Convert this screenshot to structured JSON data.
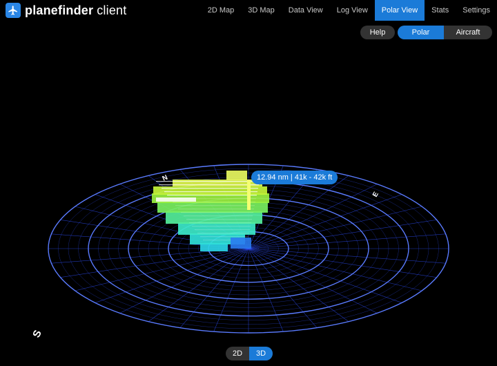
{
  "app": {
    "brand_bold": "plane",
    "brand_mid": "finder",
    "brand_rest": "client"
  },
  "nav": {
    "items": [
      {
        "label": "2D Map",
        "active": false
      },
      {
        "label": "3D Map",
        "active": false
      },
      {
        "label": "Data View",
        "active": false
      },
      {
        "label": "Log View",
        "active": false
      },
      {
        "label": "Polar View",
        "active": true
      },
      {
        "label": "Stats",
        "active": false
      },
      {
        "label": "Settings",
        "active": false
      }
    ]
  },
  "controls": {
    "help_label": "Help",
    "polar_label": "Polar",
    "aircraft_label": "Aircraft",
    "view_2d_label": "2D",
    "view_3d_label": "3D",
    "view_selected": "3D"
  },
  "polar": {
    "compass": {
      "north": "N",
      "east": "E",
      "south": "S"
    },
    "tooltip": "12.94 nm | 41k - 42k ft",
    "colors": {
      "grid": "#2f4fff",
      "accent": "#1b7bd8"
    }
  }
}
